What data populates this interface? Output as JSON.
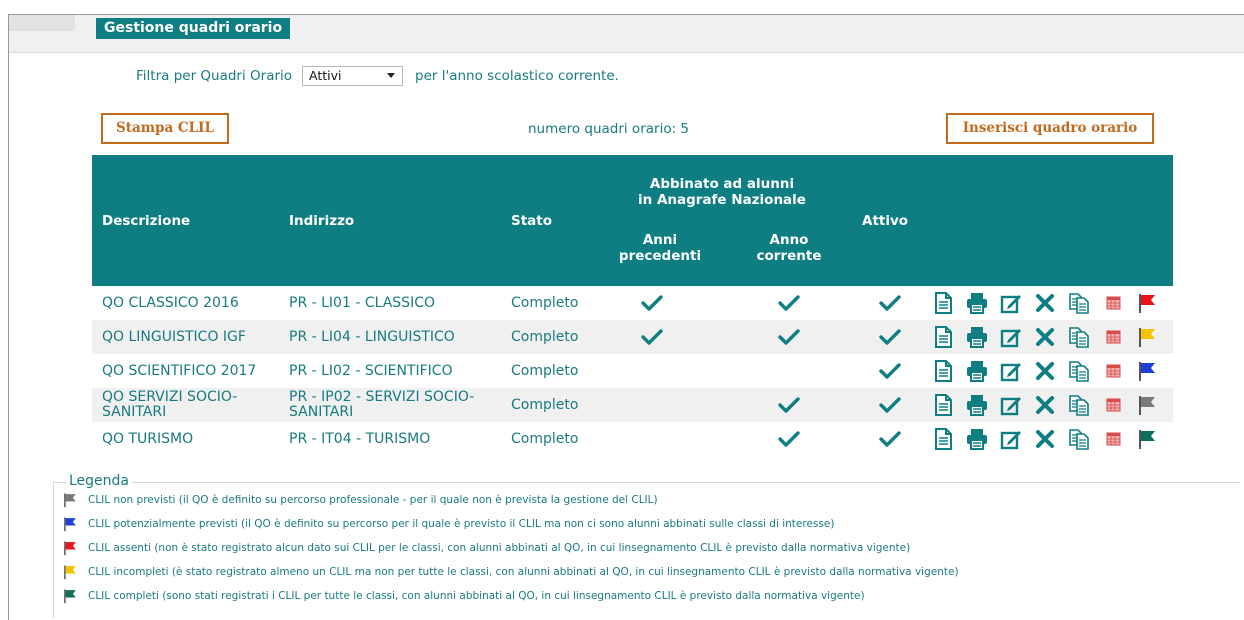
{
  "header": {
    "title": "Gestione quadri orario"
  },
  "filter": {
    "prefix": "Filtra per Quadri Orario",
    "selected": "Attivi",
    "suffix": "per l'anno scolastico corrente."
  },
  "toolbar": {
    "stampa_label": "Stampa CLIL",
    "count_label": "numero quadri orario: 5",
    "inserisci_label": "Inserisci quadro orario"
  },
  "table": {
    "headers": {
      "descrizione": "Descrizione",
      "indirizzo": "Indirizzo",
      "stato": "Stato",
      "abbinato_line1": "Abbinato ad alunni",
      "abbinato_line2": "in Anagrafe Nazionale",
      "anni_line1": "Anni",
      "anni_line2": "precedenti",
      "anno_line1": "Anno",
      "anno_line2": "corrente",
      "attivo": "Attivo"
    },
    "rows": [
      {
        "descrizione": "QO CLASSICO 2016",
        "indirizzo": "PR - LI01 - CLASSICO",
        "stato": "Completo",
        "anni_precedenti": true,
        "anno_corrente": true,
        "attivo": true,
        "flag": "red"
      },
      {
        "descrizione": "QO LINGUISTICO IGF",
        "indirizzo": "PR - LI04 - LINGUISTICO",
        "stato": "Completo",
        "anni_precedenti": true,
        "anno_corrente": true,
        "attivo": true,
        "flag": "yellow"
      },
      {
        "descrizione": "QO SCIENTIFICO 2017",
        "indirizzo": "PR - LI02 - SCIENTIFICO",
        "stato": "Completo",
        "anni_precedenti": false,
        "anno_corrente": false,
        "attivo": true,
        "flag": "blue"
      },
      {
        "descrizione": "QO SERVIZI SOCIO-SANITARI",
        "indirizzo": "PR - IP02 - SERVIZI SOCIO-SANITARI",
        "stato": "Completo",
        "anni_precedenti": false,
        "anno_corrente": true,
        "attivo": true,
        "flag": "gray"
      },
      {
        "descrizione": "QO TURISMO",
        "indirizzo": "PR - IT04 - TURISMO",
        "stato": "Completo",
        "anni_precedenti": false,
        "anno_corrente": true,
        "attivo": true,
        "flag": "green"
      }
    ],
    "row_actions": [
      "document-icon",
      "print-icon",
      "edit-icon",
      "delete-icon",
      "copy-icon",
      "calendar-icon"
    ]
  },
  "legend": {
    "title": "Legenda",
    "items": [
      {
        "flag": "gray",
        "text": "CLIL non previsti (il QO è definito su percorso  professionale - per il quale non è prevista la gestione del CLIL)"
      },
      {
        "flag": "blue",
        "text": "CLIL potenzialmente previsti (il QO è definito su percorso per il quale è previsto il CLIL ma non ci sono alunni abbinati sulle classi di interesse)"
      },
      {
        "flag": "red",
        "text": "CLIL assenti (non è stato registrato alcun dato sui CLIL per le classi, con alunni abbinati al QO, in cui linsegnamento CLIL è previsto dalla normativa vigente)"
      },
      {
        "flag": "yellow",
        "text": "CLIL incompleti (è stato registrato almeno un CLIL ma non per tutte le classi, con alunni abbinati al QO, in cui linsegnamento CLIL è previsto dalla normativa vigente)"
      },
      {
        "flag": "green",
        "text": "CLIL completi (sono stati registrati i CLIL per tutte le classi, con alunni abbinati al QO, in cui linsegnamento CLIL è previsto dalla normativa vigente)"
      }
    ]
  },
  "colors": {
    "teal": "#0e7e82",
    "link": "#187a80",
    "button_accent": "#c46a1e",
    "flag_red": "#e8131b",
    "flag_yellow": "#f4c400",
    "flag_blue": "#1f3fd6",
    "flag_gray": "#7a7a7a",
    "flag_green": "#0e6e5a"
  }
}
